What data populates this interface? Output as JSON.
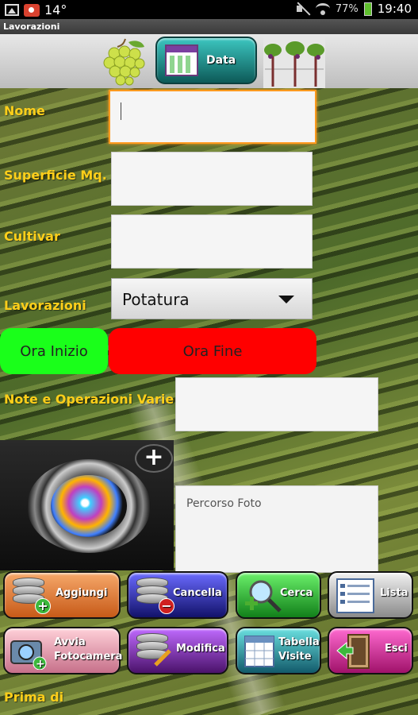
{
  "status_bar": {
    "temperature": "14°",
    "battery": "77%",
    "time": "19:40"
  },
  "app": {
    "title": "Lavorazioni"
  },
  "header": {
    "data_button_label": "Data"
  },
  "form": {
    "nome_label": "Nome",
    "nome_value": "",
    "superficie_label": "Superficie Mq.",
    "superficie_value": "",
    "cultivar_label": "Cultivar",
    "cultivar_value": "",
    "lavorazioni_label": "Lavorazioni",
    "lavorazioni_selected": "Potatura",
    "ora_inizio_label": "Ora Inizio",
    "ora_fine_label": "Ora Fine",
    "note_label": "Note e Operazioni Varie",
    "note_value": "",
    "foto_placeholder": "Percorso Foto"
  },
  "buttons": {
    "aggiungi": "Aggiungi",
    "cancella": "Cancella",
    "cerca": "Cerca",
    "lista": "Lista",
    "avvia_line1": "Avvia",
    "avvia_line2": "Fotocamera",
    "modifica": "Modifica",
    "tabella_line1": "Tabella",
    "tabella_line2": "Visite",
    "esci": "Esci"
  },
  "footer": {
    "prima_di_label": "Prima di"
  },
  "colors": {
    "label_yellow": "#ffcf1a",
    "ora_inizio_bg": "#1aff1a",
    "ora_fine_bg": "#ff0000",
    "field_focus": "#ff9a1f"
  }
}
